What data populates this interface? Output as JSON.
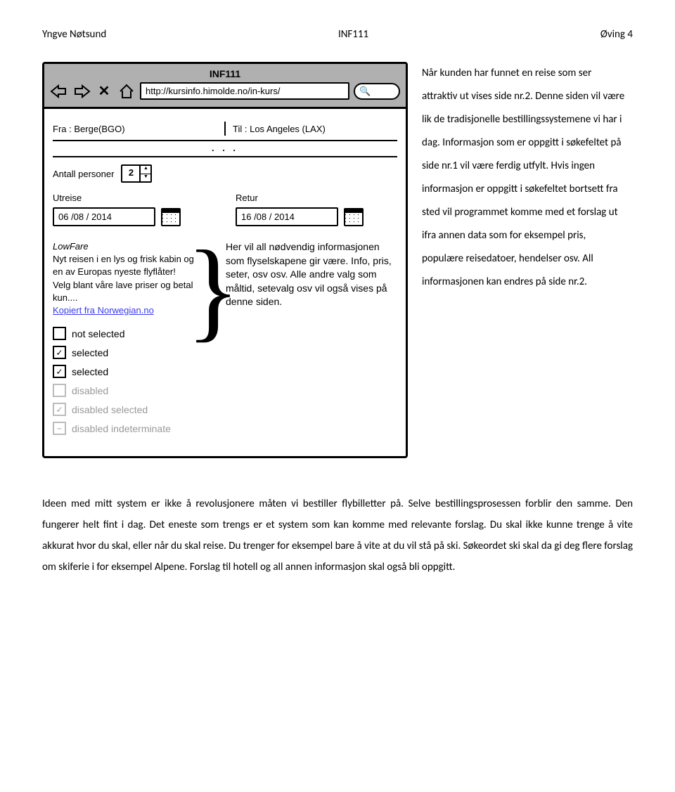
{
  "header": {
    "left": "Yngve Nøtsund",
    "center": "INF111",
    "right": "Øving 4"
  },
  "browser": {
    "title": "INF111",
    "url": "http://kursinfo.himolde.no/in-kurs/",
    "search_icon": "🔍"
  },
  "route": {
    "from_label": "Fra :",
    "from_value": "Berge(BGO)",
    "to_label": "Til :",
    "to_value": "Los Angeles (LAX)"
  },
  "persons": {
    "label": "Antall personer",
    "value": "2"
  },
  "dates": {
    "out_label": "Utreise",
    "out_value": "06 /08 / 2014",
    "ret_label": "Retur",
    "ret_value": "16 /08 / 2014"
  },
  "fare": {
    "title": "LowFare",
    "line1": "Nyt reisen i en lys og frisk kabin og en av Europas nyeste flyflåter!",
    "line2": "Velg blant våre lave priser og betal kun....",
    "link": "Kopiert fra Norwegian.no"
  },
  "checkboxes": [
    {
      "label": "not selected",
      "checked": false,
      "disabled": false
    },
    {
      "label": "selected",
      "checked": true,
      "disabled": false
    },
    {
      "label": "selected",
      "checked": true,
      "disabled": false
    },
    {
      "label": "disabled",
      "checked": false,
      "disabled": true
    },
    {
      "label": "disabled selected",
      "checked": true,
      "disabled": true
    },
    {
      "label": "disabled indeterminate",
      "checked": "indeterminate",
      "disabled": true
    }
  ],
  "annotation": "Her vil all nødvendig informasjonen som flyselskapene gir være. Info, pris, seter, osv osv. Alle andre valg som måltid, setevalg osv vil også vises på denne siden.",
  "side_paragraph": "Når kunden har funnet en reise som ser attraktiv ut vises side nr.2. Denne siden vil være lik de tradisjonelle bestillingssystemene vi har i dag. Informasjon som er oppgitt i søkefeltet på side nr.1 vil være ferdig utfylt. Hvis ingen informasjon er oppgitt i søkefeltet bortsett fra sted vil programmet komme med et forslag ut ifra annen data som for eksempel pris, populære reisedatoer, hendelser osv. All informasjonen kan endres på side nr.2.",
  "footer_paragraph": "Ideen med mitt system er ikke å revolusjonere måten vi bestiller flybilletter på. Selve bestillingsprosessen forblir den samme. Den fungerer helt fint i dag. Det eneste som trengs er et system som kan komme med relevante forslag. Du skal ikke kunne trenge å vite akkurat hvor du skal, eller når du skal reise. Du trenger for eksempel bare å vite at du vil stå på ski. Søkeordet ski skal da gi deg flere forslag om skiferie i for eksempel Alpene. Forslag til hotell og all annen informasjon skal også bli oppgitt."
}
